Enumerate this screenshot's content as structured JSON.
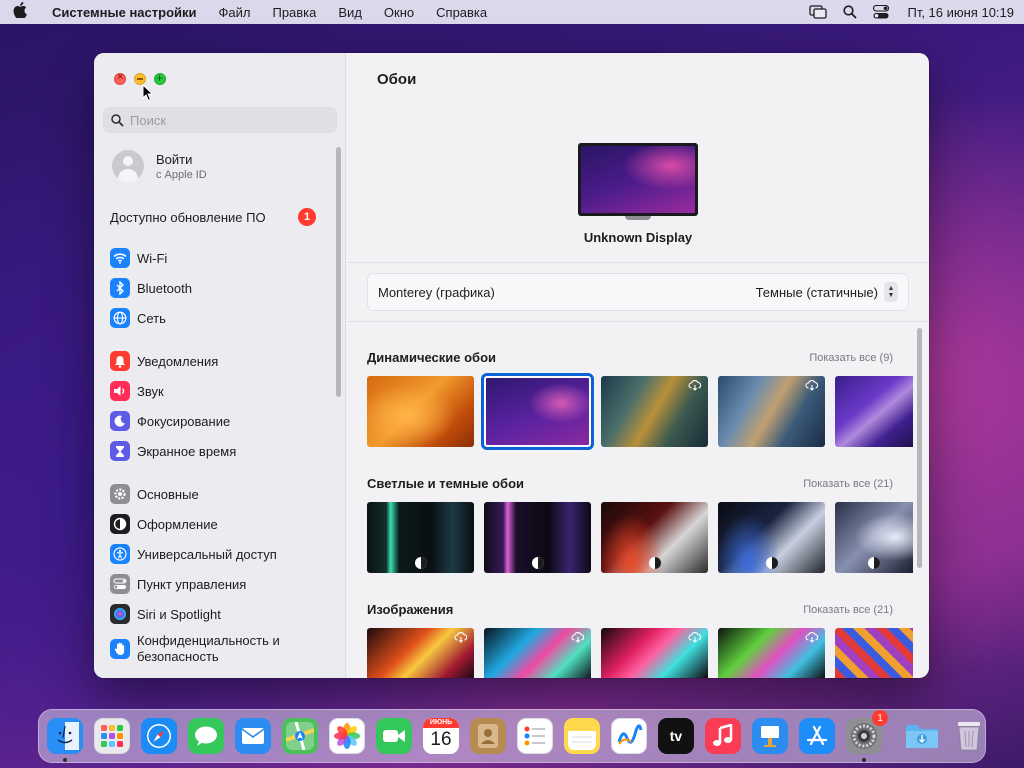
{
  "menubar": {
    "app_name": "Системные настройки",
    "items": [
      "Файл",
      "Правка",
      "Вид",
      "Окно",
      "Справка"
    ],
    "clock": "Пт, 16 июня  10:19"
  },
  "sidebar": {
    "search_placeholder": "Поиск",
    "account": {
      "title": "Войти",
      "subtitle": "с Apple ID"
    },
    "update": {
      "label": "Доступно обновление ПО",
      "badge": "1"
    },
    "items": [
      {
        "label": "Wi‑Fi",
        "icon": "wifi-icon",
        "color": "#1a82fb"
      },
      {
        "label": "Bluetooth",
        "icon": "bluetooth-icon",
        "color": "#1a82fb"
      },
      {
        "label": "Сеть",
        "icon": "globe-icon",
        "color": "#1a82fb"
      },
      {
        "label": "Уведомления",
        "icon": "bell-icon",
        "color": "#ff3b30"
      },
      {
        "label": "Звук",
        "icon": "speaker-icon",
        "color": "#ff2d55"
      },
      {
        "label": "Фокусирование",
        "icon": "moon-icon",
        "color": "#5e5ce6"
      },
      {
        "label": "Экранное время",
        "icon": "hourglass-icon",
        "color": "#5e5ce6"
      },
      {
        "label": "Основные",
        "icon": "gear-icon",
        "color": "#8e8e93"
      },
      {
        "label": "Оформление",
        "icon": "appearance-icon",
        "color": "#1d1d1f"
      },
      {
        "label": "Универсальный доступ",
        "icon": "accessibility-icon",
        "color": "#1a82fb"
      },
      {
        "label": "Пункт управления",
        "icon": "control-center-icon",
        "color": "#8e8e93"
      },
      {
        "label": "Siri и Spotlight",
        "icon": "siri-icon",
        "color": "#2b2b2b"
      },
      {
        "label": "Конфиденциальность и безопасность",
        "icon": "hand-icon",
        "color": "#1a82fb"
      }
    ]
  },
  "main": {
    "title": "Обои",
    "display_name": "Unknown Display",
    "wallpaper_name": "Monterey (графика)",
    "wallpaper_mode": "Темные (статичные)",
    "sections": [
      {
        "title": "Динамические обои",
        "show_all": "Показать все (9)"
      },
      {
        "title": "Светлые и темные обои",
        "show_all": "Показать все (21)"
      },
      {
        "title": "Изображения",
        "show_all": "Показать все (21)"
      }
    ]
  },
  "dock": {
    "items": [
      {
        "name": "finder-icon",
        "label": "Finder",
        "color": "#2b8ef5"
      },
      {
        "name": "launchpad-icon",
        "label": "Launchpad",
        "color": "#e9e9ee"
      },
      {
        "name": "safari-icon",
        "label": "Safari",
        "color": "#1b8cf6"
      },
      {
        "name": "messages-icon",
        "label": "Сообщения",
        "color": "#34c759"
      },
      {
        "name": "mail-icon",
        "label": "Почта",
        "color": "#2d8cf0"
      },
      {
        "name": "maps-icon",
        "label": "Карты",
        "color": "#4cc05a"
      },
      {
        "name": "photos-icon",
        "label": "Фото",
        "color": "#ffffff"
      },
      {
        "name": "facetime-icon",
        "label": "FaceTime",
        "color": "#34c759"
      },
      {
        "name": "calendar-icon",
        "label": "Календарь",
        "color": "#ffffff",
        "month": "ИЮНЬ",
        "day": "16"
      },
      {
        "name": "contacts-icon",
        "label": "Контакты",
        "color": "#b58b52"
      },
      {
        "name": "reminders-icon",
        "label": "Напоминания",
        "color": "#ffffff"
      },
      {
        "name": "notes-icon",
        "label": "Заметки",
        "color": "#fed84d"
      },
      {
        "name": "freeform-icon",
        "label": "Freeform",
        "color": "#ffffff"
      },
      {
        "name": "tv-icon",
        "label": "TV",
        "color": "#111111",
        "text": "tv"
      },
      {
        "name": "music-icon",
        "label": "Музыка",
        "color": "#fa3d55"
      },
      {
        "name": "keynote-icon",
        "label": "Keynote",
        "color": "#2d8cf0"
      },
      {
        "name": "app-store-icon",
        "label": "App Store",
        "color": "#1d8ef7"
      },
      {
        "name": "system-settings-icon",
        "label": "Системные настройки",
        "color": "#8e8e93",
        "badge": "1"
      }
    ],
    "extra": [
      {
        "name": "downloads-folder-icon",
        "label": "Загрузки",
        "color": "#5ab4f0"
      },
      {
        "name": "trash-icon",
        "label": "Корзина",
        "color": "#e6e6ea"
      }
    ]
  }
}
